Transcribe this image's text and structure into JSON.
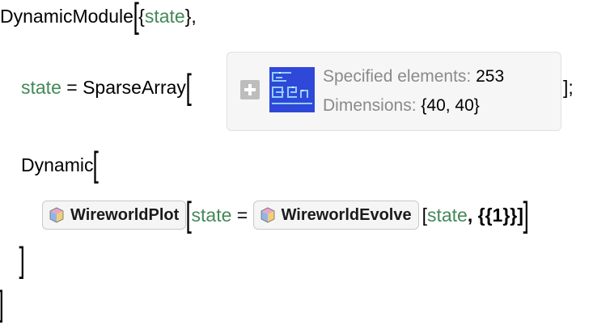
{
  "code": {
    "line1": {
      "head": "DynamicModule",
      "open": "[",
      "brace_open": "{",
      "local": "state",
      "brace_close": "},"
    },
    "line2": {
      "lhs": "state",
      "eq": " = ",
      "head": "SparseArray",
      "open": "[",
      "close": "];"
    },
    "line3": {
      "head": "Dynamic",
      "open": "["
    },
    "line4": {
      "open1": "[",
      "local1": "state",
      "eq": " = ",
      "open2": "[",
      "local2": "state",
      "args": ", {{1}}]",
      "close": "]"
    },
    "line5": {
      "close": "]"
    },
    "line6": {
      "close": "]"
    }
  },
  "sparse_summary": {
    "specified_label": "Specified elements:",
    "specified_value": "253",
    "dimensions_label": "Dimensions:",
    "dimensions_value": "{40, 40}",
    "expand_icon": "plus-icon",
    "thumbnail_color": "#2f48d8"
  },
  "functions": {
    "plot": {
      "label": "WireworldPlot",
      "icon": "resource-cube-icon"
    },
    "evolve": {
      "label": "WireworldEvolve",
      "icon": "resource-cube-icon"
    }
  },
  "colors": {
    "local_variable": "#438958",
    "summary_background": "#f6f6f6",
    "summary_label": "#8a8a8a"
  }
}
